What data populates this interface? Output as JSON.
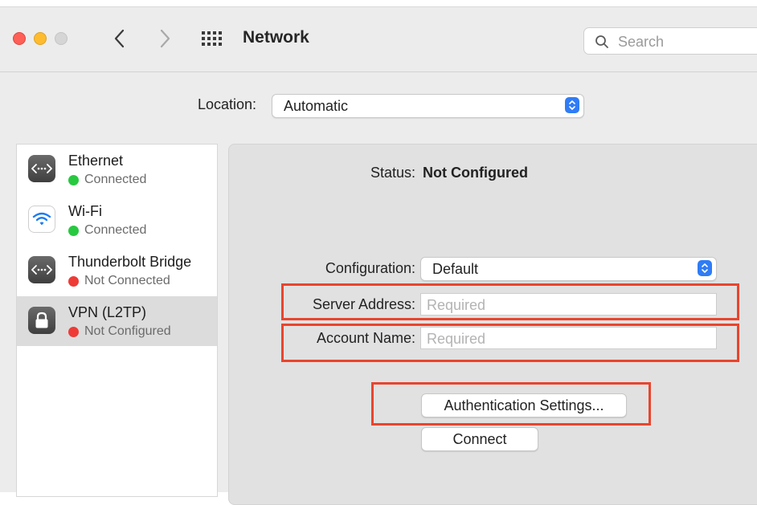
{
  "window": {
    "title": "Network",
    "search_placeholder": "Search"
  },
  "location": {
    "label": "Location:",
    "value": "Automatic"
  },
  "sidebar": {
    "items": [
      {
        "name": "Ethernet",
        "status": "Connected",
        "status_color": "#28c840",
        "icon": "ethernet-icon"
      },
      {
        "name": "Wi-Fi",
        "status": "Connected",
        "status_color": "#28c840",
        "icon": "wifi-icon"
      },
      {
        "name": "Thunderbolt Bridge",
        "status": "Not Connected",
        "status_color": "#ee3b36",
        "icon": "ethernet-icon"
      },
      {
        "name": "VPN (L2TP)",
        "status": "Not Configured",
        "status_color": "#ee3b36",
        "icon": "lock-icon",
        "selected": true
      }
    ]
  },
  "detail": {
    "status_label": "Status:",
    "status_value": "Not Configured",
    "configuration_label": "Configuration:",
    "configuration_value": "Default",
    "server_address_label": "Server Address:",
    "server_address_placeholder": "Required",
    "server_address_value": "",
    "account_name_label": "Account Name:",
    "account_name_placeholder": "Required",
    "account_name_value": "",
    "auth_button": "Authentication Settings...",
    "connect_button": "Connect"
  },
  "colors": {
    "accent": "#2f7cf6",
    "highlight": "#e8452e",
    "green": "#28c840",
    "red": "#ee3b36"
  }
}
